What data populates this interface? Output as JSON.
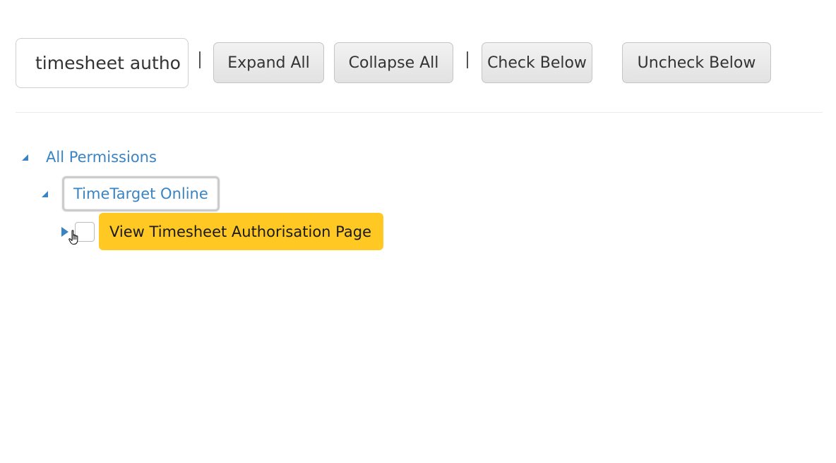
{
  "toolbar": {
    "search_value": "timesheet autho",
    "separator": "|",
    "expand_all_label": "Expand All",
    "collapse_all_label": "Collapse All",
    "check_below_label": "Check Below",
    "uncheck_below_label": "Uncheck Below"
  },
  "tree": {
    "root": {
      "label": "All Permissions",
      "expanded": true,
      "icon": "triangle-down-icon"
    },
    "group": {
      "label": "TimeTarget Online",
      "expanded": true,
      "icon": "triangle-down-icon",
      "focused": true
    },
    "leaf": {
      "label": "View Timesheet Authorisation Page",
      "expanded": false,
      "checked": false,
      "icon": "triangle-right-icon",
      "highlighted": true
    }
  },
  "colors": {
    "link": "#3a84c3",
    "highlight": "#ffc823",
    "button_bg": "#e9e9e9"
  },
  "cursor": {
    "icon": "hand-pointer-icon"
  }
}
